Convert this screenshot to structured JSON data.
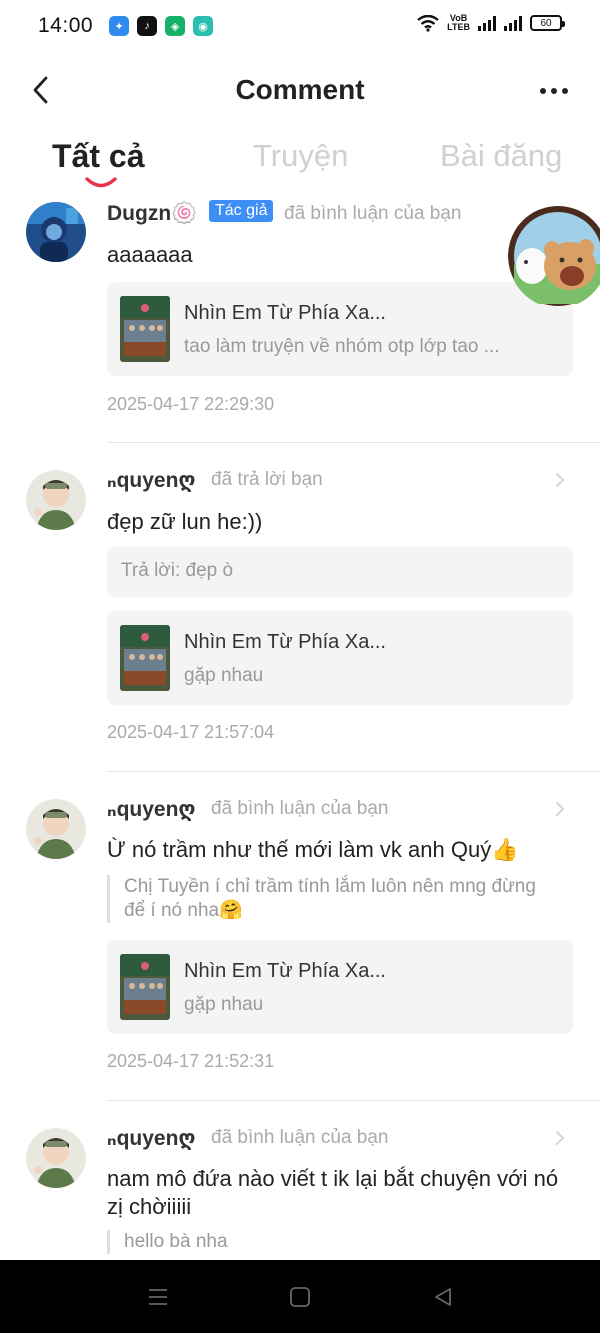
{
  "status_bar": {
    "time": "14:00",
    "volte_top": "VoB",
    "volte_bottom": "LTEB",
    "battery": "60"
  },
  "header": {
    "title": "Comment"
  },
  "tabs": [
    {
      "label": "Tất cả",
      "active": true
    },
    {
      "label": "Truyện",
      "active": false
    },
    {
      "label": "Bài đăng",
      "active": false
    }
  ],
  "items": [
    {
      "username": "Dugzn🍥",
      "badge": "Tác giả",
      "action": "đã bình luận của bạn",
      "comment": "aaaaaaa",
      "story_title": "Nhìn Em Từ Phía Xa...",
      "story_sub": "tao làm truyện về nhóm otp lớp tao ...",
      "timestamp": "2025-04-17 22:29:30"
    },
    {
      "username": "ₙquyenღ",
      "action": "đã trả lời bạn",
      "comment": "đẹp zữ lun he:))",
      "reply": "Trả lời: đẹp ò",
      "story_title": "Nhìn Em Từ Phía Xa...",
      "story_sub": "gặp nhau",
      "timestamp": "2025-04-17 21:57:04"
    },
    {
      "username": "ₙquyenღ",
      "action": "đã bình luận của bạn",
      "comment": "Ừ nó trầm như thế mới làm vk anh Quý👍",
      "quote": "Chị Tuyền í chỉ trầm tính lắm luôn nên mng đừng để í nó nha🤗",
      "story_title": "Nhìn Em Từ Phía Xa...",
      "story_sub": "gặp nhau",
      "timestamp": "2025-04-17 21:52:31"
    },
    {
      "username": "ₙquyenღ",
      "action": "đã bình luận của bạn",
      "comment": "nam mô đứa nào viết t ik lại bắt chuyện với nó zị chờiiiii",
      "quote": "hello bà nha"
    }
  ],
  "colors": {
    "accent_red": "#e8334a",
    "badge_blue": "#3d8ef5",
    "card_bg": "#f4f4f4"
  }
}
